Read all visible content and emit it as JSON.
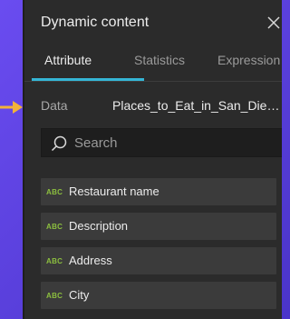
{
  "panel": {
    "title": "Dynamic content",
    "close_icon": "close-icon"
  },
  "tabs": [
    {
      "label": "Attribute",
      "active": true
    },
    {
      "label": "Statistics",
      "active": false
    },
    {
      "label": "Expression",
      "active": false
    }
  ],
  "data_source": {
    "label": "Data",
    "value": "Places_to_Eat_in_San_Dieg…"
  },
  "search": {
    "placeholder": "Search",
    "value": ""
  },
  "fields": [
    {
      "type": "ABC",
      "label": "Restaurant name"
    },
    {
      "type": "ABC",
      "label": "Description"
    },
    {
      "type": "ABC",
      "label": "Address"
    },
    {
      "type": "ABC",
      "label": "City"
    }
  ],
  "colors": {
    "accent": "#35b6d6",
    "field_type": "#8cbf3f",
    "panel_bg": "#2b2b2b",
    "arrow": "#f2b23a"
  },
  "icons": {
    "pointer": "arrow-right-icon",
    "search": "search-icon",
    "close": "close-icon"
  }
}
